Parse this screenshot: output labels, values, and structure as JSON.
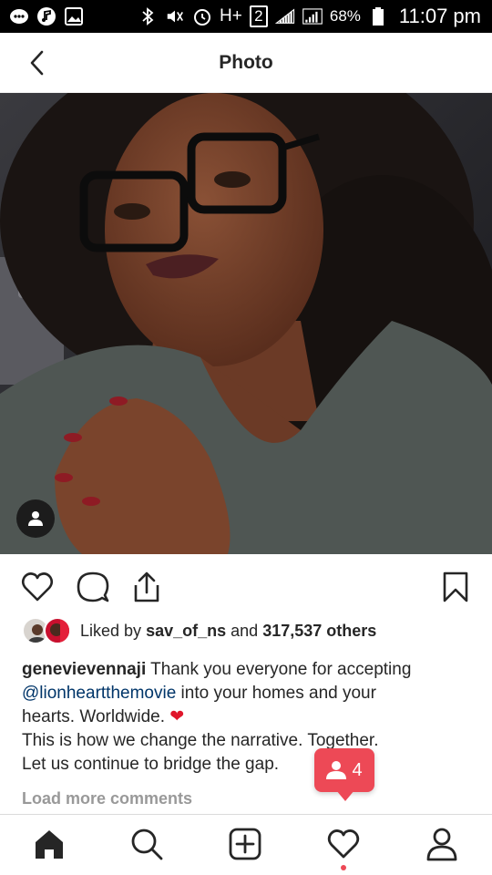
{
  "status_bar": {
    "signal_label": "H+",
    "sim_label": "2",
    "battery": "68%",
    "time": "11:07 pm"
  },
  "header": {
    "title": "Photo"
  },
  "post": {
    "likes": {
      "prefix": "Liked by",
      "user": "sav_of_ns",
      "conjunction": "and",
      "others": "317,537 others"
    },
    "caption": {
      "username": "genevievennaji",
      "line1": "Thank you everyone for accepting",
      "mention": "@lionheartthemovie",
      "line2_rest": "into your homes and your",
      "line3": "hearts. Worldwide.",
      "heart": "❤",
      "line4": "This is how we change the narrative. Together.",
      "line5": "Let us continue to bridge the gap."
    },
    "load_more": "Load more comments"
  },
  "notification": {
    "count": "4"
  },
  "colors": {
    "accent_red": "#ed4956",
    "mention_blue": "#003569"
  },
  "icons": {
    "actions": [
      "heart-icon",
      "comment-icon",
      "share-icon",
      "bookmark-icon"
    ],
    "nav": [
      "home-icon",
      "search-icon",
      "add-post-icon",
      "activity-heart-icon",
      "profile-icon"
    ]
  }
}
